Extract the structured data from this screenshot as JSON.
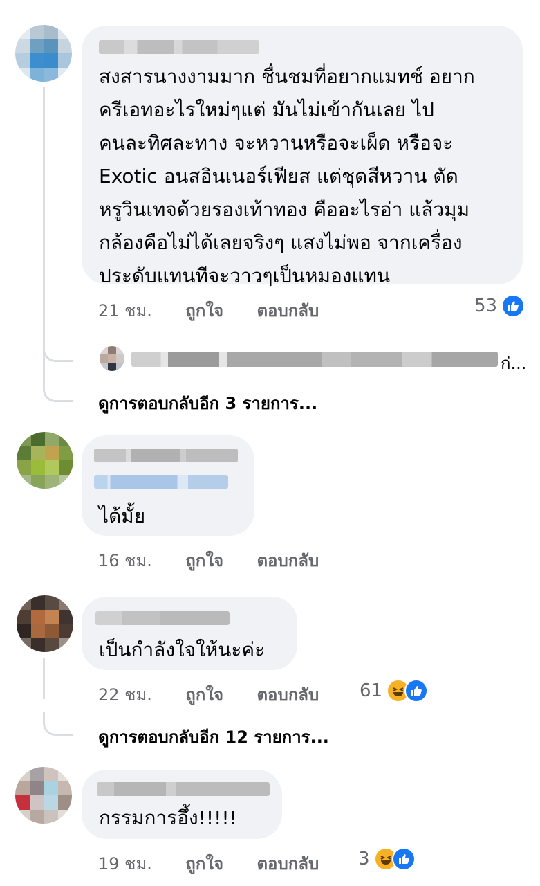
{
  "comments": [
    {
      "text_lines": [
        "สงสารนางงามมาก ชื่นชมที่อยากแมทช์ อยาก",
        "ครีเอทอะไรใหม่ๆแต่ มันไม่เข้ากันเลย ไป",
        "คนละทิศละทาง จะหวานหรือจะเผ็ด หรือจะ",
        "Exotic อนสอินเนอร์เฟียส แต่ชุดสีหวาน ตัด",
        "หรูวินเทจด้วยรองเท้าทอง คืออะไรอ่า แล้วมุม",
        "กล้องคือไม่ได้เลยจริงๆ แสงไม่พอ จากเครื่อง",
        "ประดับแทนทีจะวาวๆเป็นหมองแทน"
      ],
      "time": "21 ชม.",
      "like_label": "ถูกใจ",
      "reply_label": "ตอบกลับ",
      "reaction_count": "53",
      "reaction_icons": [
        "like-icon"
      ],
      "reply_preview_suffix": "ก่...",
      "more_replies": "ดูการตอบกลับอีก 3 รายการ..."
    },
    {
      "text_lines": [
        "ได้มั้ย"
      ],
      "time": "16 ชม.",
      "like_label": "ถูกใจ",
      "reply_label": "ตอบกลับ"
    },
    {
      "text_lines": [
        "เป็นกำลังใจให้นะค่ะ"
      ],
      "time": "22 ชม.",
      "like_label": "ถูกใจ",
      "reply_label": "ตอบกลับ",
      "reaction_count": "61",
      "reaction_icons": [
        "haha-icon",
        "like-icon"
      ],
      "more_replies": "ดูการตอบกลับอีก 12 รายการ..."
    },
    {
      "text_lines": [
        "กรรมการอึ้ง!!!!!"
      ],
      "time": "19 ชม.",
      "like_label": "ถูกใจ",
      "reply_label": "ตอบกลับ",
      "reaction_count": "3",
      "reaction_icons": [
        "haha-icon",
        "like-icon"
      ]
    }
  ],
  "colors": {
    "bubble": "#f0f2f5",
    "meta_text": "#65676b",
    "like_blue": "#1877f2",
    "haha_yellow": "#f7b125"
  }
}
